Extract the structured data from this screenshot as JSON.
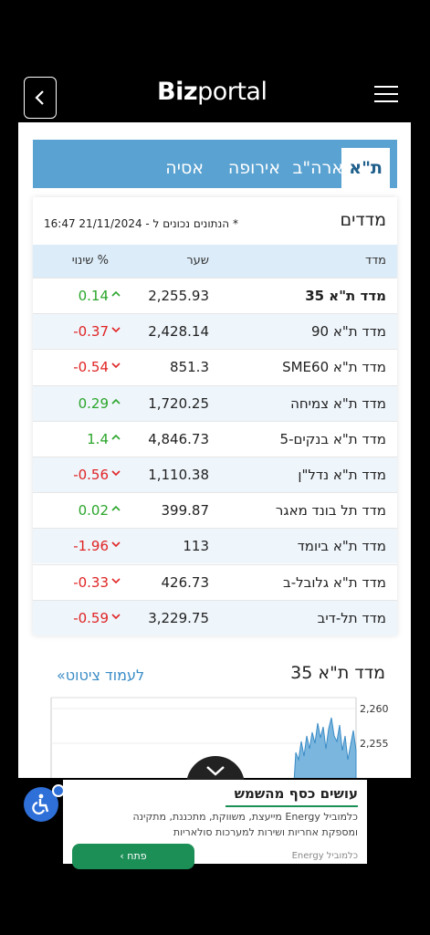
{
  "header": {
    "logo_bold": "Biz",
    "logo_light": "portal"
  },
  "tabs": [
    {
      "label": "ת\"א",
      "active": true
    },
    {
      "label": "ארה\"ב",
      "active": false
    },
    {
      "label": "אירופה",
      "active": false
    },
    {
      "label": "אסיה",
      "active": false
    }
  ],
  "indices": {
    "title": "מדדים",
    "note": "* הנתונים נכונים ל - 21/11/2024 16:47",
    "columns": {
      "name": "מדד",
      "rate": "שער",
      "change": "% שינוי"
    },
    "rows": [
      {
        "name": "מדד ת\"א 35",
        "rate": "2,255.93",
        "change": "0.14",
        "direction": "up"
      },
      {
        "name": "מדד ת\"א 90",
        "rate": "2,428.14",
        "change": "-0.37",
        "direction": "down"
      },
      {
        "name": "מדד ת\"א SME60",
        "rate": "851.3",
        "change": "-0.54",
        "direction": "down"
      },
      {
        "name": "מדד ת\"א צמיחה",
        "rate": "1,720.25",
        "change": "0.29",
        "direction": "up"
      },
      {
        "name": "מדד ת\"א בנקים-5",
        "rate": "4,846.73",
        "change": "1.4",
        "direction": "up"
      },
      {
        "name": "מדד ת\"א נדל\"ן",
        "rate": "1,110.38",
        "change": "-0.56",
        "direction": "down"
      },
      {
        "name": "מדד תל בונד מאגר",
        "rate": "399.87",
        "change": "0.02",
        "direction": "up"
      },
      {
        "name": "מדד ת\"א ביומד",
        "rate": "113",
        "change": "-1.96",
        "direction": "down"
      },
      {
        "name": "מדד ת\"א גלובל-ב",
        "rate": "426.73",
        "change": "-0.33",
        "direction": "down"
      },
      {
        "name": "מדד תל-דיב",
        "rate": "3,229.75",
        "change": "-0.59",
        "direction": "down"
      }
    ]
  },
  "ta35": {
    "title": "מדד ת\"א 35",
    "quote_link": "לעמוד ציטוט»"
  },
  "chart_data": {
    "type": "area",
    "y_ticks": [
      "2,260",
      "2,255"
    ],
    "ylim": [
      2250,
      2261
    ]
  },
  "ad": {
    "title": "עושים כסף מהשמש",
    "text1": "כלמוביל Energy מייעצת, משווקת, מתכננת, מתקינה",
    "text2": "ומספקת אחריות ושירות למערכות סולאריות",
    "button": "פתח",
    "brand": "כלמוביל Energy"
  },
  "colors": {
    "tab_bar": "#5aa2d1",
    "up": "#2aa52a",
    "down": "#e02424",
    "link": "#3a8cc6"
  }
}
